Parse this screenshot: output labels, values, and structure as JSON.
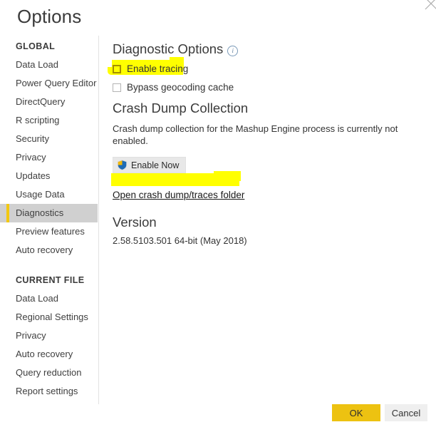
{
  "dialog": {
    "title": "Options",
    "close_icon": "close-icon"
  },
  "sidebar": {
    "groups": [
      {
        "title": "GLOBAL",
        "items": [
          {
            "label": "Data Load",
            "selected": false
          },
          {
            "label": "Power Query Editor",
            "selected": false
          },
          {
            "label": "DirectQuery",
            "selected": false
          },
          {
            "label": "R scripting",
            "selected": false
          },
          {
            "label": "Security",
            "selected": false
          },
          {
            "label": "Privacy",
            "selected": false
          },
          {
            "label": "Updates",
            "selected": false
          },
          {
            "label": "Usage Data",
            "selected": false
          },
          {
            "label": "Diagnostics",
            "selected": true
          },
          {
            "label": "Preview features",
            "selected": false
          },
          {
            "label": "Auto recovery",
            "selected": false
          }
        ]
      },
      {
        "title": "CURRENT FILE",
        "items": [
          {
            "label": "Data Load",
            "selected": false
          },
          {
            "label": "Regional Settings",
            "selected": false
          },
          {
            "label": "Privacy",
            "selected": false
          },
          {
            "label": "Auto recovery",
            "selected": false
          },
          {
            "label": "Query reduction",
            "selected": false
          },
          {
            "label": "Report settings",
            "selected": false
          }
        ]
      }
    ],
    "selected_accent_color": "#f2c811"
  },
  "content": {
    "diagnostic_options": {
      "heading": "Diagnostic Options",
      "info_icon": "info-icon",
      "info_glyph": "i",
      "checkboxes": [
        {
          "label": "Enable tracing",
          "checked": false,
          "highlighted": true
        },
        {
          "label": "Bypass geocoding cache",
          "checked": false,
          "highlighted": false
        }
      ]
    },
    "crash_dump": {
      "heading": "Crash Dump Collection",
      "description": "Crash dump collection for the Mashup Engine process is currently not enabled.",
      "enable_button_label": "Enable Now",
      "enable_button_icon": "uac-shield-icon",
      "link_label": "Open crash dump/traces folder",
      "link_highlighted": true
    },
    "version": {
      "heading": "Version",
      "value": "2.58.5103.501 64-bit (May 2018)"
    }
  },
  "footer": {
    "ok_label": "OK",
    "cancel_label": "Cancel",
    "ok_color": "#edc211",
    "cancel_color": "#efefef"
  },
  "annotation": {
    "marker_color": "#ffff00",
    "marker_checkbox_border_color": "#a59000"
  }
}
